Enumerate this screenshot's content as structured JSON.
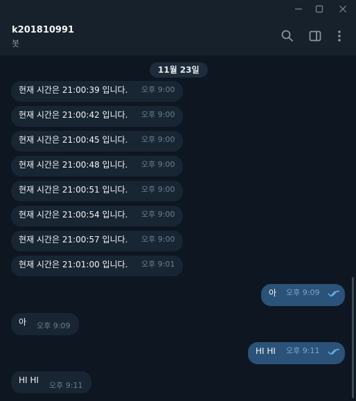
{
  "window": {},
  "header": {
    "title": "k201810991",
    "subtitle": "봇"
  },
  "date_label": "11월 23일",
  "messages": [
    {
      "dir": "in",
      "text": "현재 시간은 21:00:39 입니다.",
      "time": "오후 9:00"
    },
    {
      "dir": "in",
      "text": "현재 시간은 21:00:42 입니다.",
      "time": "오후 9:00"
    },
    {
      "dir": "in",
      "text": "현재 시간은 21:00:45 입니다.",
      "time": "오후 9:00"
    },
    {
      "dir": "in",
      "text": "현재 시간은 21:00:48 입니다.",
      "time": "오후 9:00"
    },
    {
      "dir": "in",
      "text": "현재 시간은 21:00:51 입니다.",
      "time": "오후 9:00"
    },
    {
      "dir": "in",
      "text": "현재 시간은 21:00:54 입니다.",
      "time": "오후 9:00"
    },
    {
      "dir": "in",
      "text": "현재 시간은 21:00:57 입니다.",
      "time": "오후 9:00"
    },
    {
      "dir": "in",
      "text": "현재 시간은 21:01:00 입니다.",
      "time": "오후 9:01"
    },
    {
      "dir": "out",
      "text": "아",
      "time": "오후 9:09"
    },
    {
      "dir": "in",
      "text": "아",
      "time": "오후 9:09"
    },
    {
      "dir": "out",
      "text": "HI HI",
      "time": "오후 9:11"
    },
    {
      "dir": "in",
      "text": "HI HI",
      "time": "오후 9:11"
    }
  ],
  "colors": {
    "background": "#0e1621",
    "header": "#17212b",
    "incoming_bubble": "#182533",
    "outgoing_bubble": "#2b5278",
    "read_check": "#6cb3f0"
  },
  "icons": {
    "minimize": "minimize-icon",
    "maximize": "maximize-icon",
    "close": "close-icon",
    "search": "search-icon",
    "sidebar": "sidebar-toggle-icon",
    "menu": "more-vertical-icon",
    "read": "double-check-icon"
  }
}
